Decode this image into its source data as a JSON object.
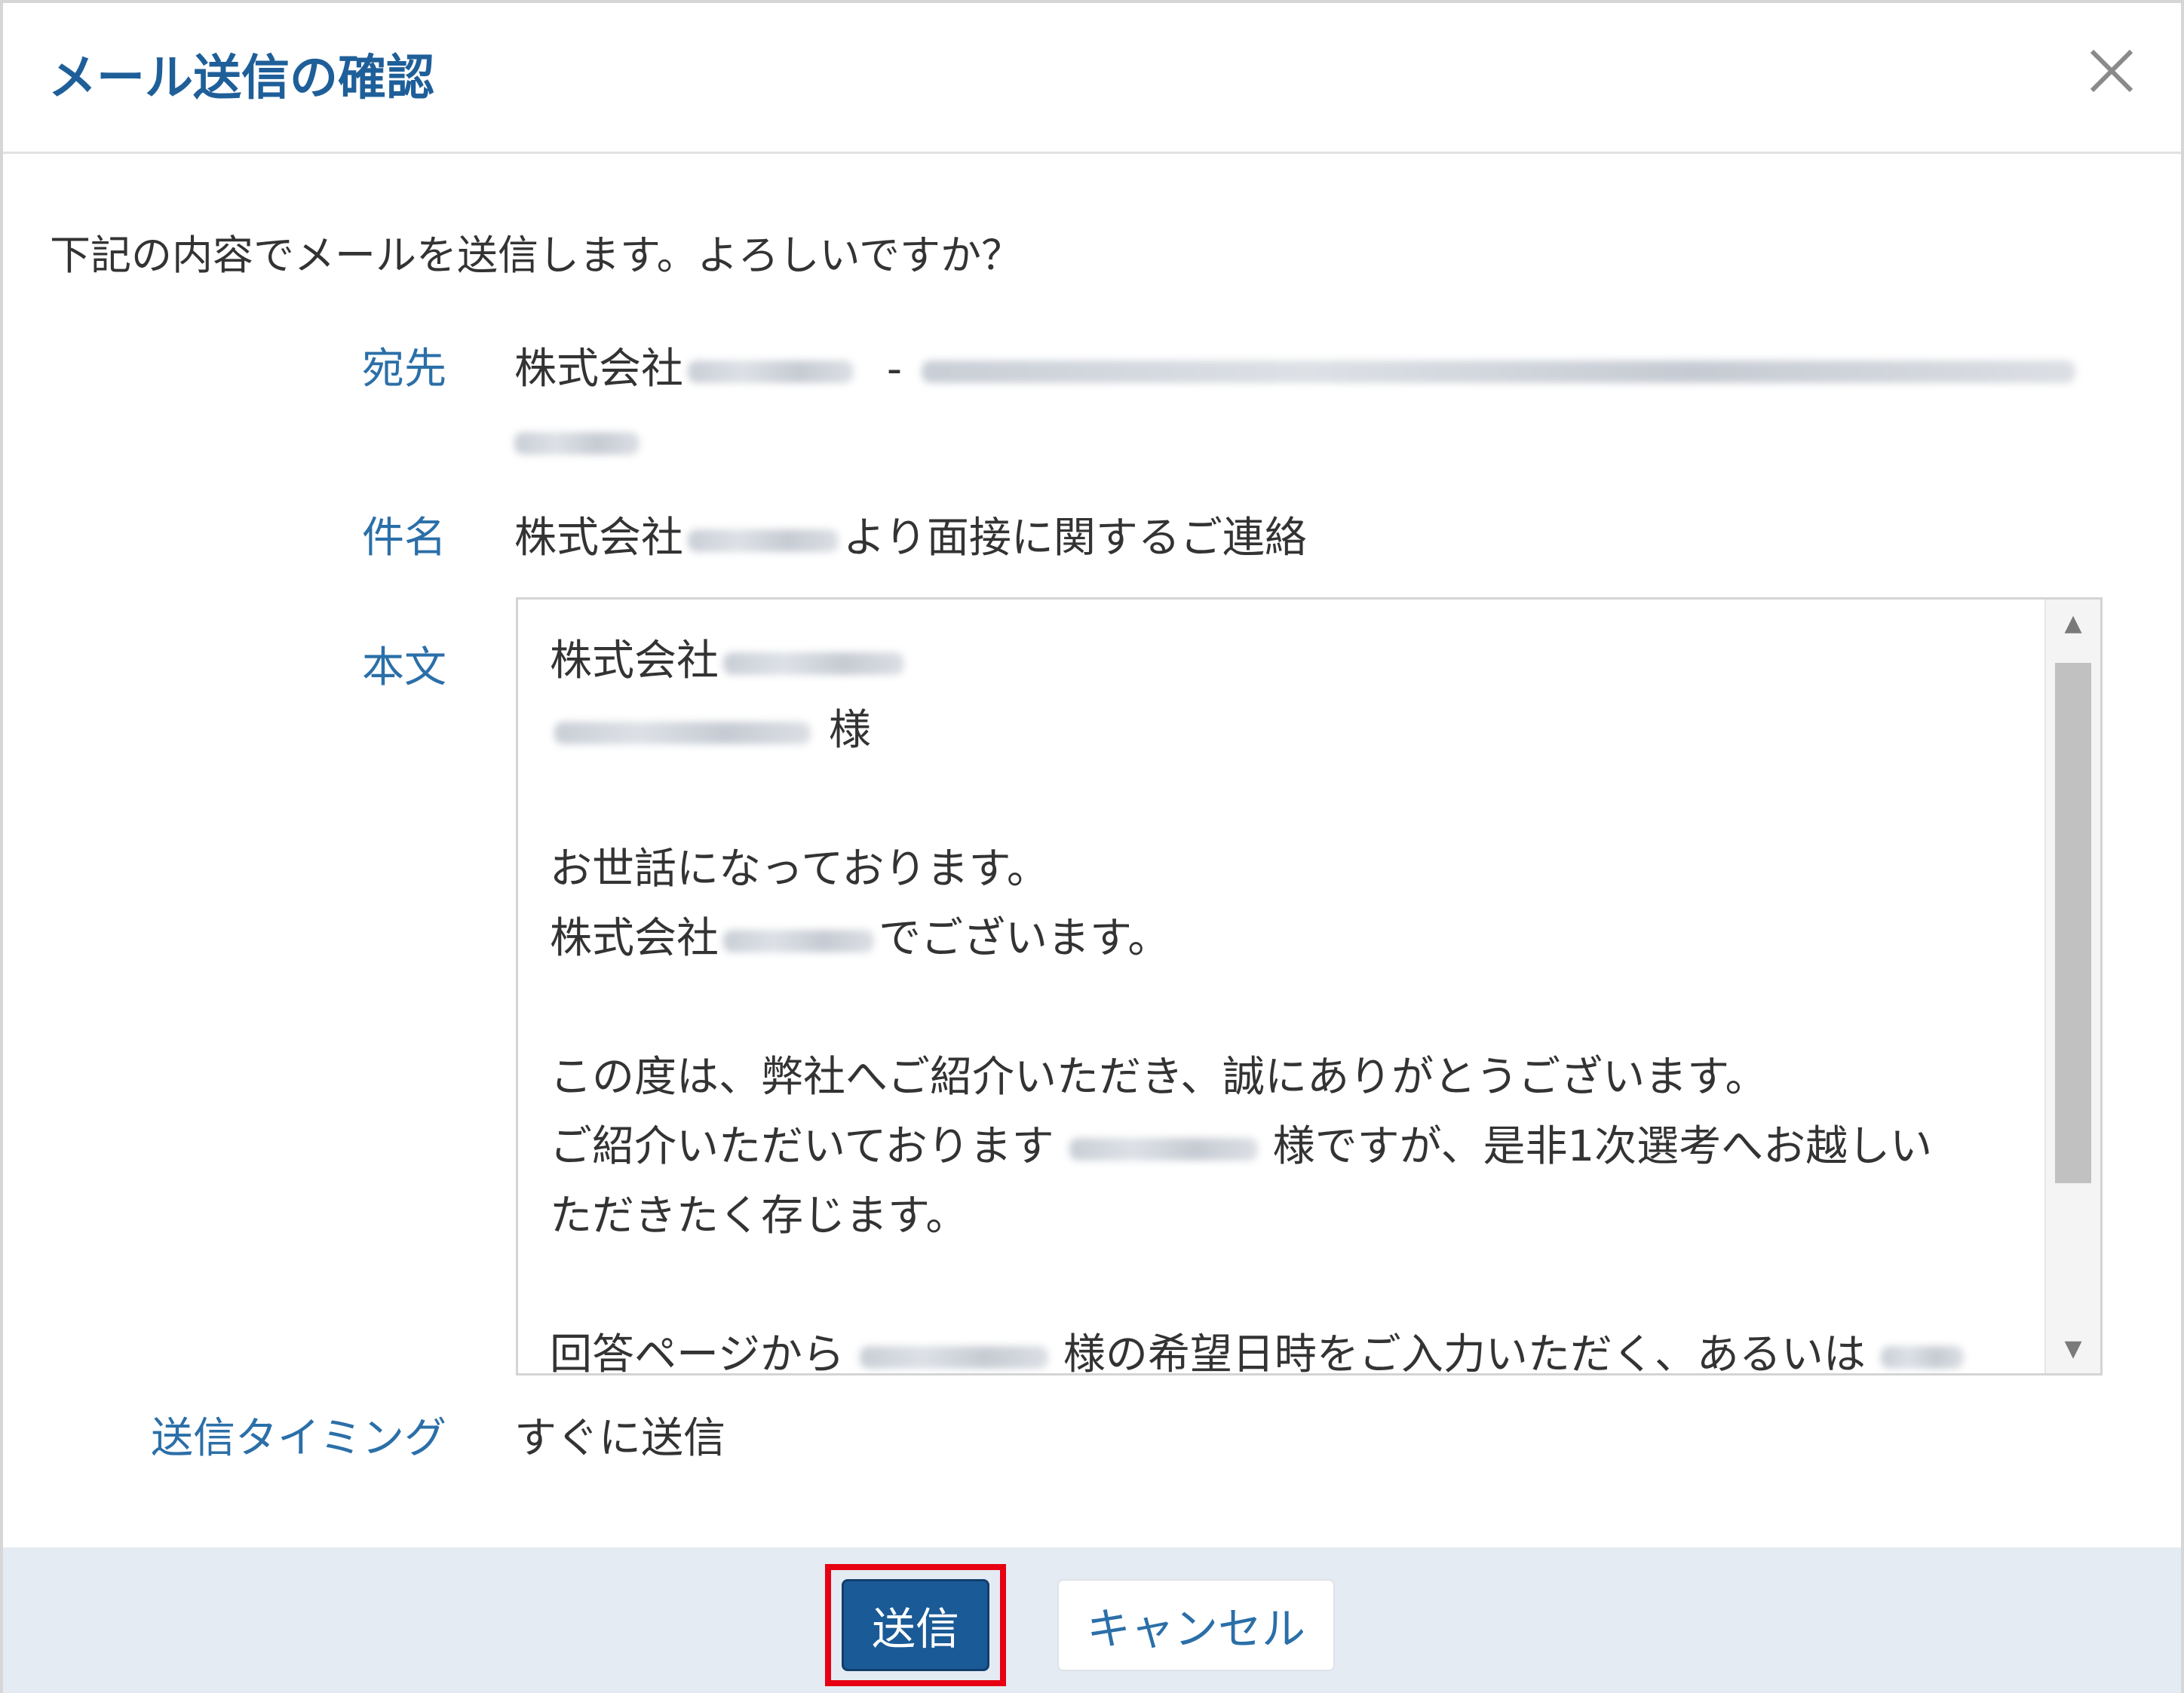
{
  "dialog": {
    "title": "メール送信の確認",
    "close_icon": "close-icon"
  },
  "intro": "下記の内容でメールを送信します。よろしいですか？",
  "fields": {
    "to_label": "宛先",
    "to_company_prefix": "株式会社",
    "to_separator": "-",
    "subject_label": "件名",
    "subject_prefix": "株式会社",
    "subject_suffix": "より面接に関するご連絡",
    "body_label": "本文",
    "timing_label": "送信タイミング",
    "timing_value": "すぐに送信"
  },
  "body": {
    "line1_prefix": "株式会社",
    "line2_suffix": "様",
    "line4": "お世話になっております。",
    "line5_prefix": "株式会社",
    "line5_suffix": "でございます。",
    "line7": "この度は、弊社へご紹介いただき、誠にありがとうございます。",
    "line8_prefix": "ご紹介いただいております",
    "line8_suffix": "様ですが、是非1次選考へお越しい",
    "line9": "ただきたく存じます。",
    "line11_prefix": "回答ページから",
    "line11_middle": "様の希望日時をご入力いただく、あるいは"
  },
  "scrollbar": {
    "up_arrow": "▲",
    "down_arrow": "▼"
  },
  "footer": {
    "send_label": "送信",
    "cancel_label": "キャンセル"
  },
  "colors": {
    "title": "#1f5f99",
    "label": "#2b6fa8",
    "send_button": "#1a5a96",
    "highlight": "#e60012",
    "footer_bg": "#e4ebf3"
  }
}
